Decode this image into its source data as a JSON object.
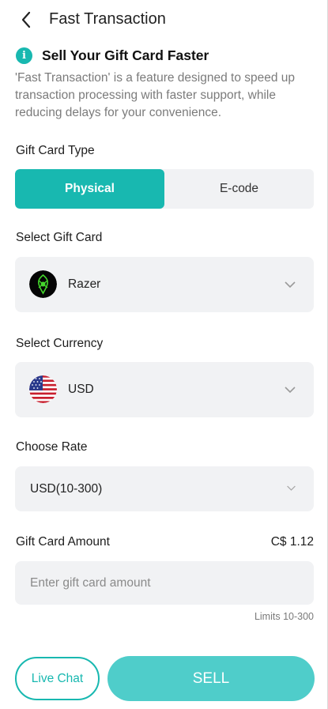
{
  "header": {
    "title": "Fast Transaction",
    "back_icon": "chevron-left-icon"
  },
  "info": {
    "icon": "info-icon",
    "icon_glyph": "i",
    "title": "Sell Your Gift Card Faster",
    "description": "'Fast Transaction' is a feature designed to speed up transaction processing with faster support, while reducing delays for your convenience."
  },
  "card_type": {
    "label": "Gift Card Type",
    "options": [
      "Physical",
      "E-code"
    ],
    "selected": "Physical"
  },
  "gift_card": {
    "label": "Select Gift Card",
    "value": "Razer",
    "icon": "razer-logo-icon"
  },
  "currency": {
    "label": "Select Currency",
    "value": "USD",
    "icon": "us-flag-icon"
  },
  "rate": {
    "label": "Choose Rate",
    "value": "USD(10-300)"
  },
  "amount": {
    "label": "Gift Card Amount",
    "value": "C$ 1.12",
    "placeholder": "Enter gift card amount",
    "limits": "Limits 10-300"
  },
  "actions": {
    "live_chat": "Live Chat",
    "sell": "SELL"
  },
  "colors": {
    "accent": "#18b8b0",
    "sell_button": "#4fcdca",
    "field_bg": "#f1f2f4"
  }
}
